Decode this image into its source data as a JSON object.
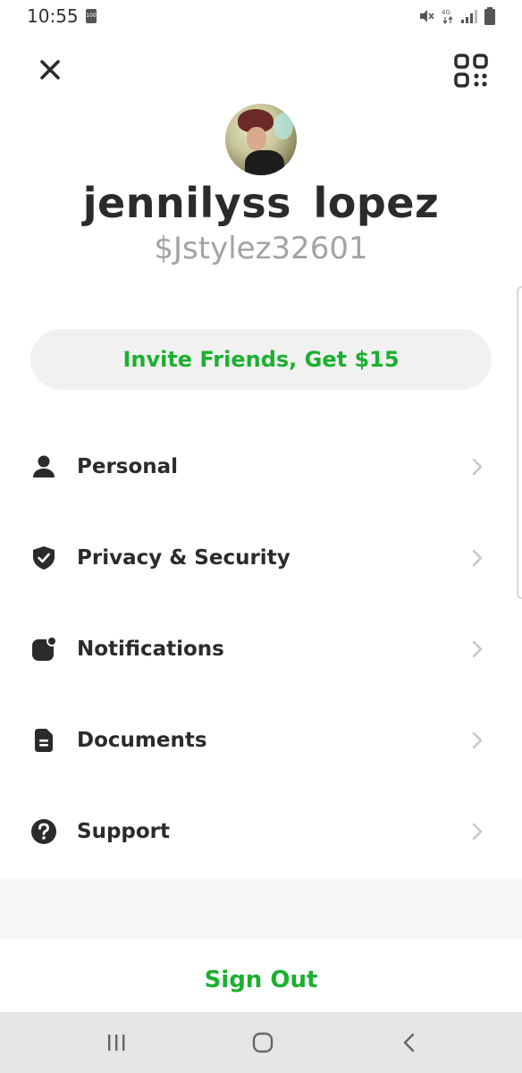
{
  "status_bar": {
    "time": "10:55",
    "battery_badge": "100",
    "icons": [
      "mute-icon",
      "4g-icon",
      "signal-icon",
      "battery-icon"
    ]
  },
  "header": {
    "close_icon": "close-icon",
    "qr_icon": "qr-code-icon"
  },
  "profile": {
    "display_name": "jennilyss  lopez",
    "cashtag": "$Jstylez32601"
  },
  "invite": {
    "label": "Invite Friends, Get $15"
  },
  "menu": {
    "items": [
      {
        "label": "Personal",
        "icon": "person-icon"
      },
      {
        "label": "Privacy & Security",
        "icon": "shield-check-icon"
      },
      {
        "label": "Notifications",
        "icon": "notification-badge-icon"
      },
      {
        "label": "Documents",
        "icon": "document-icon"
      },
      {
        "label": "Support",
        "icon": "question-icon"
      }
    ]
  },
  "footer": {
    "sign_out_label": "Sign Out"
  },
  "colors": {
    "accent_green": "#1bb02f",
    "text_dark": "#2b2b2b",
    "text_gray": "#a3a3a3",
    "chevron_gray": "#c7c7c7",
    "pill_bg": "#f1f1f1",
    "nav_bar_bg": "#e6e6e6"
  },
  "nav_bar": {
    "icons": [
      "recents-icon",
      "home-icon",
      "back-icon"
    ]
  }
}
